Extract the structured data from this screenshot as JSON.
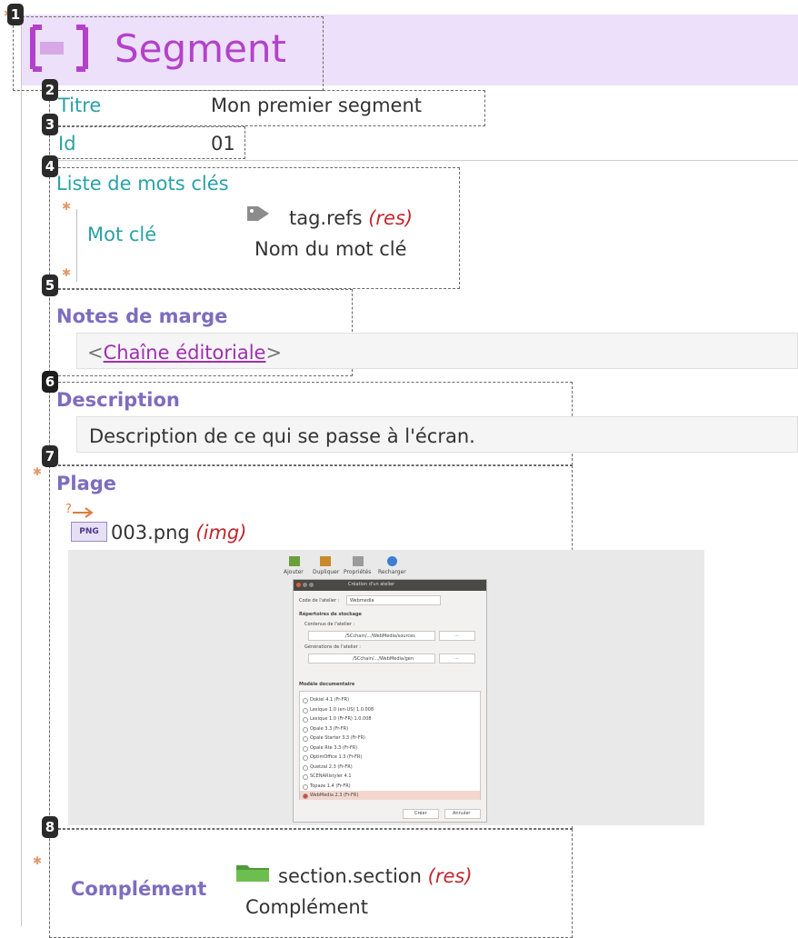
{
  "segment": {
    "title": "Segment"
  },
  "markers": [
    "1",
    "2",
    "3",
    "4",
    "5",
    "6",
    "7",
    "8"
  ],
  "titre": {
    "label": "Titre",
    "value": "Mon premier segment"
  },
  "id_field": {
    "label": "Id",
    "value": "01"
  },
  "keywords": {
    "label": "Liste de mots clés",
    "item_label": "Mot clé",
    "ref": "tag.refs",
    "ref_kind": "(res)",
    "ref_name": "Nom du mot clé"
  },
  "notes": {
    "label": "Notes de marge",
    "open": "<",
    "link": "Chaîne éditoriale",
    "close": ">"
  },
  "description": {
    "label": "Description",
    "value": "Description de ce qui se passe à l'écran."
  },
  "plage": {
    "label": "Plage",
    "file_badge": "PNG",
    "file": "003.png",
    "file_kind": "(img)",
    "toolbar": [
      "Ajouter",
      "Dupliquer",
      "Propriétés",
      "Recharger"
    ],
    "dialog": {
      "title": "Création d'un atelier",
      "code_label": "Code de l'atelier :",
      "code_value": "Webmedia",
      "repos_header": "Répertoires de stockage",
      "content_label": "Contenus de l'atelier :",
      "content_path": "/SCchain/.../WebMedia/sources",
      "gen_label": "Générations de l'atelier :",
      "gen_path": "/SCchain/.../WebMedia/gen",
      "browse": "...",
      "model_header": "Modèle documentaire",
      "models": [
        "Dokiel 4.1 (Fr-FR)",
        "Lexique 1.0 (en-US) 1.0.008",
        "Lexique 1.0 (Fr-FR) 1.0.008",
        "Opale 3.3 (Fr-FR)",
        "Opale Starter 3.3 (Fr-FR)",
        "Opale Rte 3.3 (Fr-FR)",
        "OptimOffice 1.3 (Fr-FR)",
        "Quetzal 2.3 (Fr-FR)",
        "SCENARIstyler 4.1",
        "Topaze 1.4 (Fr-FR)",
        "WebMedia 2.3 (Fr-FR)"
      ],
      "ok": "Créer",
      "cancel": "Annuler"
    }
  },
  "complement": {
    "label": "Complément",
    "ref": "section.section",
    "ref_kind": "(res)",
    "ref_name": "Complément"
  },
  "colors": {
    "header_bg": "#ece0fb",
    "title": "#b441c9",
    "field_label": "#2aa2a6",
    "section_label": "#7d6dbf",
    "res": "#c0282f",
    "link": "#9e2fb0"
  }
}
